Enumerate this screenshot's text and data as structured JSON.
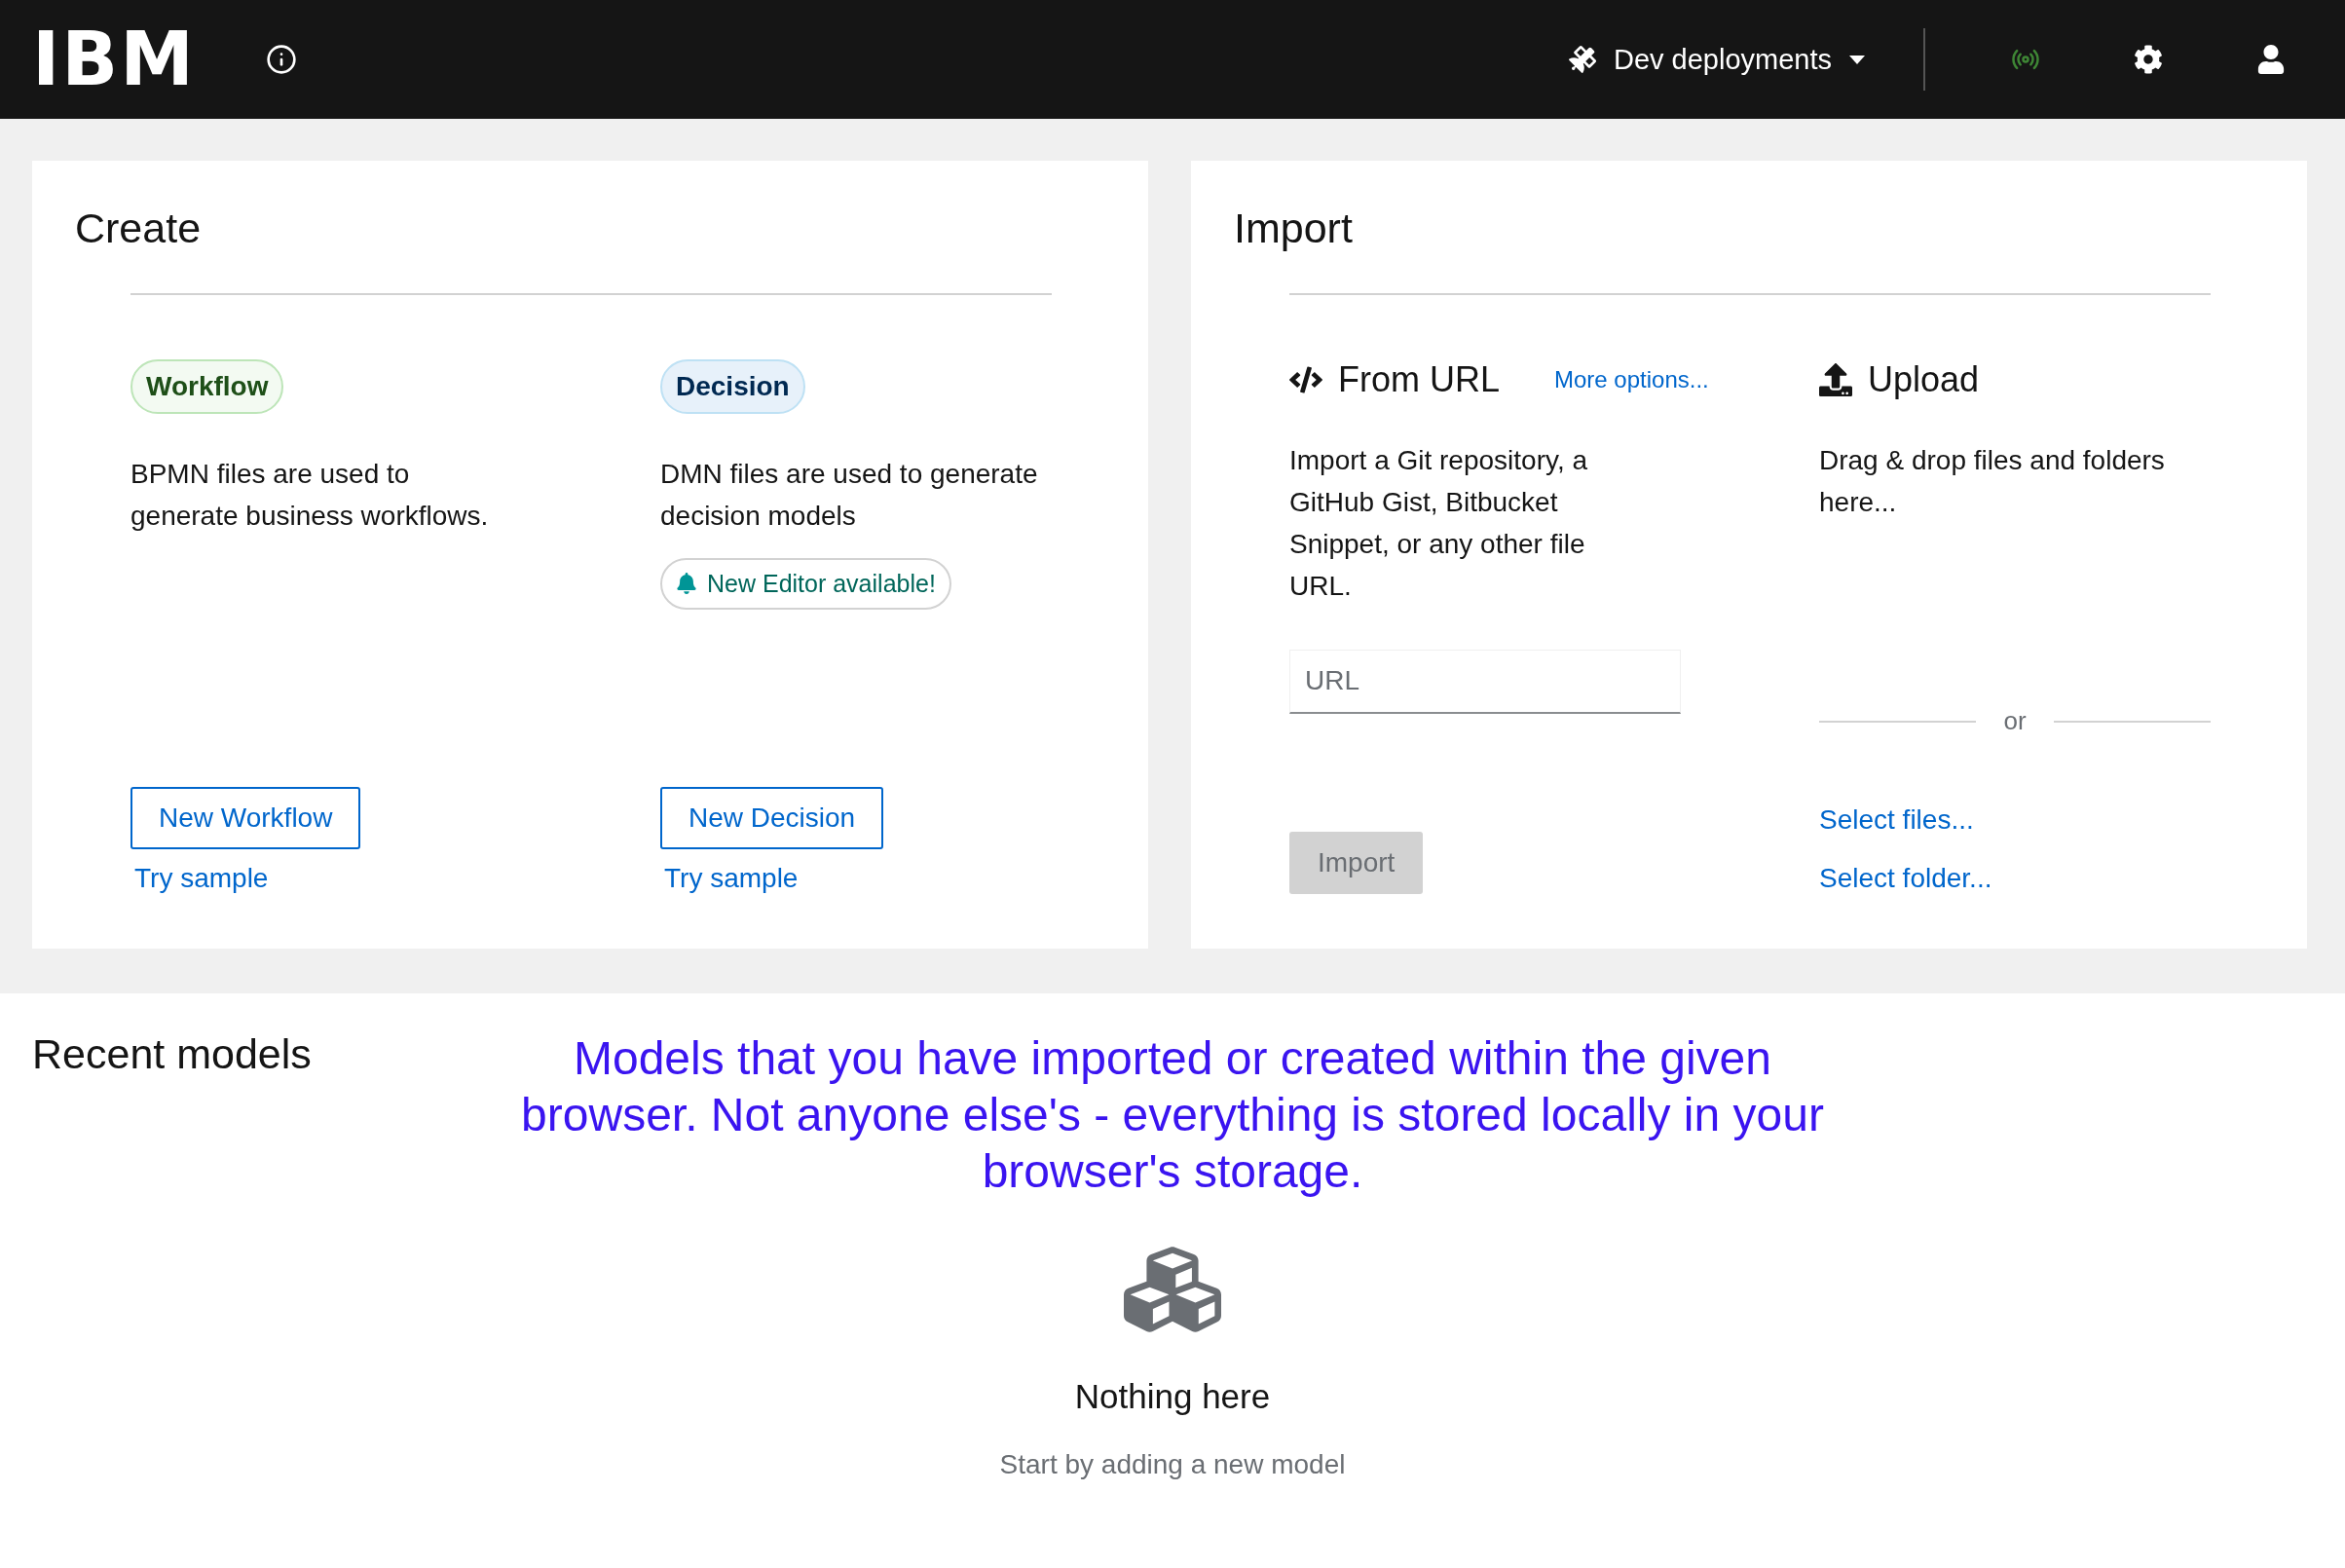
{
  "header": {
    "logo": "IBM",
    "context": "Dev deployments"
  },
  "create": {
    "title": "Create",
    "options": [
      {
        "kind": "workflow",
        "badge": "Workflow",
        "description": "BPMN files are used to generate business workflows.",
        "button": "New Workflow",
        "link": "Try sample"
      },
      {
        "kind": "decision",
        "badge": "Decision",
        "description": "DMN files are used to generate decision models",
        "notice": "New Editor available!",
        "button": "New Decision",
        "link": "Try sample"
      }
    ]
  },
  "import": {
    "title": "Import",
    "from_url": {
      "title": "From URL",
      "more_link": "More options...",
      "description": "Import a Git repository, a GitHub Gist, Bitbucket Snippet, or any other file URL.",
      "url_field": {
        "placeholder": "URL"
      },
      "button": {
        "label": "Import",
        "disabled": true
      }
    },
    "upload": {
      "title": "Upload",
      "description": "Drag & drop files and folders here...",
      "separator": "or",
      "links": [
        "Select files...",
        "Select folder..."
      ]
    }
  },
  "recent": {
    "title": "Recent models",
    "note": "Models that you have imported or created within the given browser. Not anyone else's - everything is stored locally in your browser's storage.",
    "empty": {
      "title": "Nothing here",
      "subtitle": "Start by adding a new model"
    }
  }
}
